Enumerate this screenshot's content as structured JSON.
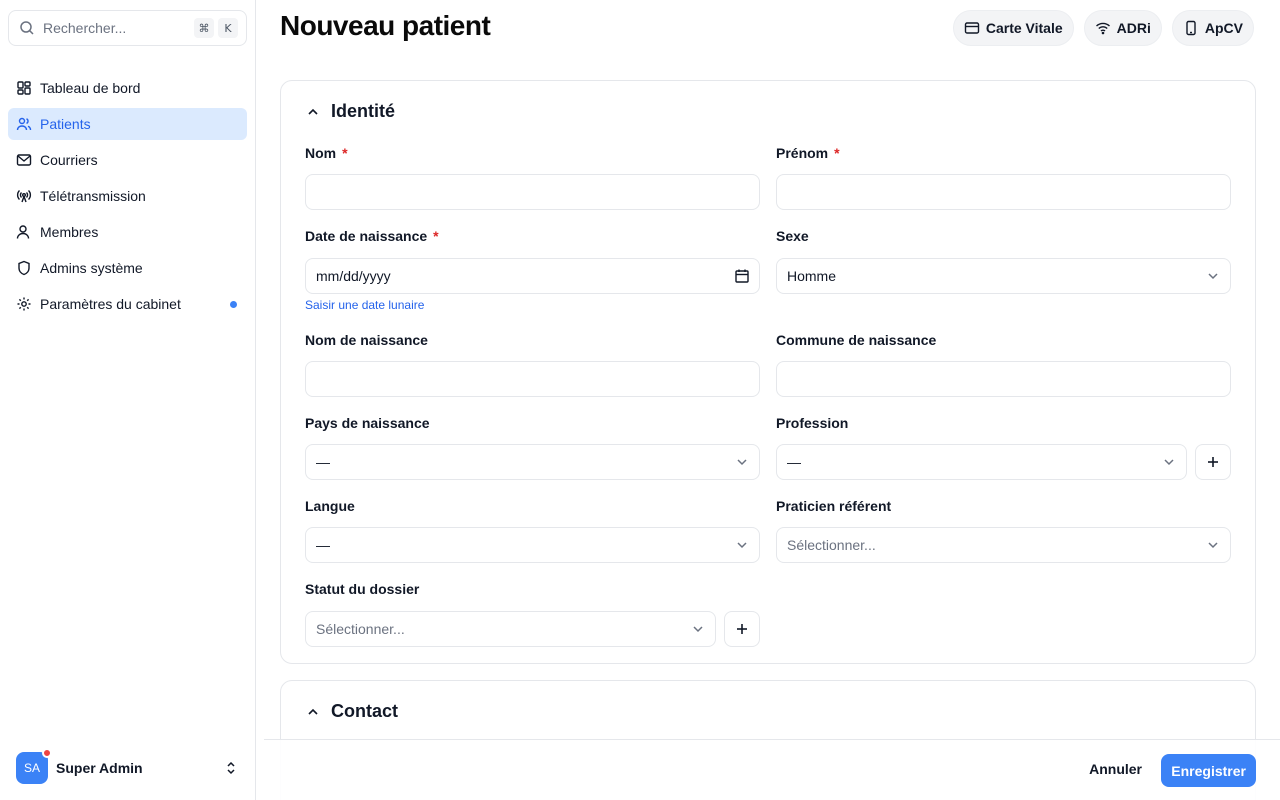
{
  "search": {
    "placeholder": "Rechercher...",
    "kbd": [
      "⌘",
      "K"
    ]
  },
  "sidebar": {
    "items": [
      {
        "label": "Tableau de bord",
        "icon": "dashboard-icon",
        "active": false
      },
      {
        "label": "Patients",
        "icon": "users-icon",
        "active": true
      },
      {
        "label": "Courriers",
        "icon": "mail-icon",
        "active": false
      },
      {
        "label": "Télétransmission",
        "icon": "antenna-icon",
        "active": false
      },
      {
        "label": "Membres",
        "icon": "user-icon",
        "active": false
      },
      {
        "label": "Admins système",
        "icon": "shield-icon",
        "active": false
      },
      {
        "label": "Paramètres du cabinet",
        "icon": "gear-icon",
        "active": false,
        "notification_dot": true
      }
    ],
    "user": {
      "initials": "SA",
      "name": "Super Admin"
    }
  },
  "header": {
    "title": "Nouveau patient",
    "buttons": [
      {
        "label": "Carte Vitale",
        "icon": "card-icon"
      },
      {
        "label": "ADRi",
        "icon": "wifi-icon"
      },
      {
        "label": "ApCV",
        "icon": "phone-icon"
      }
    ]
  },
  "identite": {
    "title": "Identité",
    "fields": {
      "nom": {
        "label": "Nom",
        "required": "*",
        "value": ""
      },
      "prenom": {
        "label": "Prénom",
        "required": "*",
        "value": ""
      },
      "date_naissance": {
        "label": "Date de naissance",
        "required": "*",
        "value": "mm/dd/yyyy",
        "link": "Saisir une date lunaire"
      },
      "sexe": {
        "label": "Sexe",
        "value": "Homme"
      },
      "nom_naissance": {
        "label": "Nom de naissance",
        "value": ""
      },
      "commune_naissance": {
        "label": "Commune de naissance",
        "value": ""
      },
      "pays_naissance": {
        "label": "Pays de naissance",
        "value": "—"
      },
      "profession": {
        "label": "Profession",
        "value": "—"
      },
      "langue": {
        "label": "Langue",
        "value": "—"
      },
      "praticien_referent": {
        "label": "Praticien référent",
        "placeholder": "Sélectionner..."
      },
      "statut_dossier": {
        "label": "Statut du dossier",
        "placeholder": "Sélectionner..."
      }
    }
  },
  "contact": {
    "title": "Contact"
  },
  "footer": {
    "cancel_label": "Annuler",
    "save_label": "Enregistrer"
  },
  "colors": {
    "accent": "#3b82f6",
    "active_bg": "#dbeafe",
    "required": "#dc2626",
    "notification": "#ef4444"
  }
}
